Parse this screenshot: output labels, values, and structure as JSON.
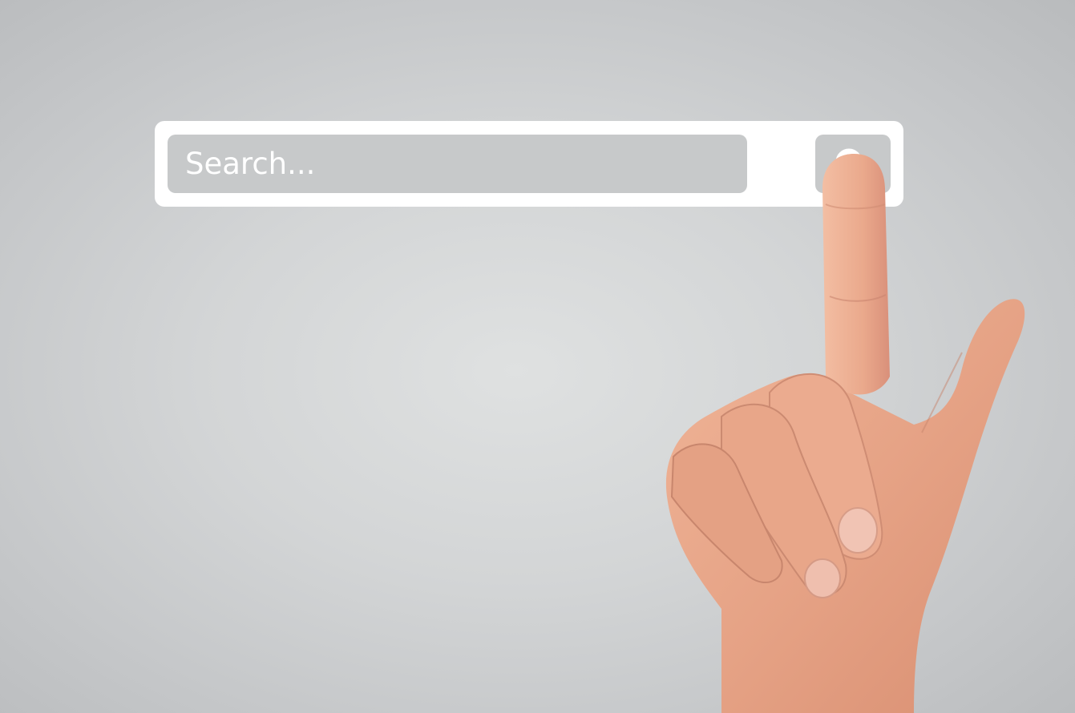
{
  "search": {
    "placeholder": "Search...",
    "value": "",
    "button_icon": "magnifier-icon"
  },
  "colors": {
    "background": "#d6d8d9",
    "bar": "#ffffff",
    "field": "#c7c9ca",
    "skin": "#e8a98a"
  }
}
